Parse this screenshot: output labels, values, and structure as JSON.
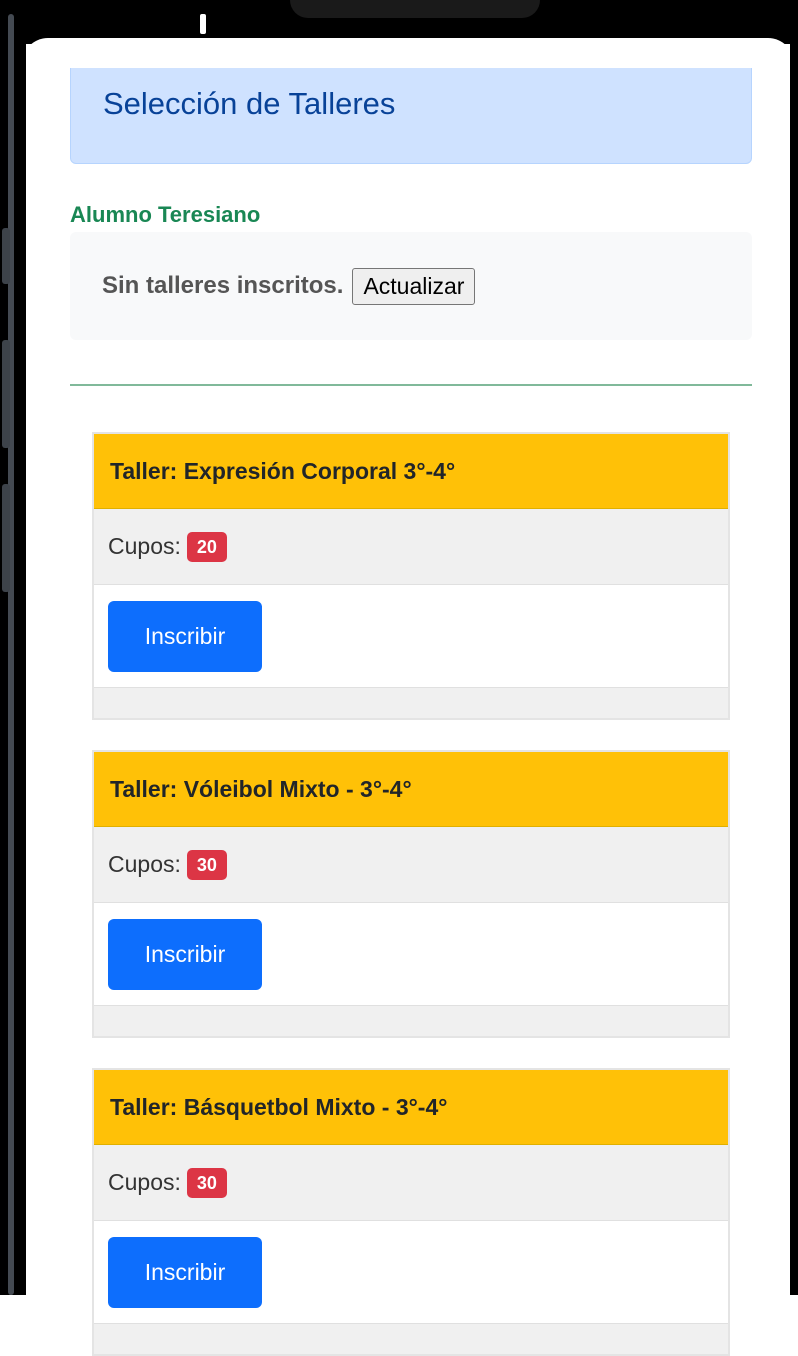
{
  "header": {
    "title": "Selección de Talleres"
  },
  "student": {
    "name": "Alumno Teresiano",
    "status_text": "Sin talleres inscritos.",
    "refresh_label": "Actualizar"
  },
  "workshops": [
    {
      "title": "Taller: Expresión Corporal 3°-4°",
      "quota_label": "Cupos:",
      "quota": "20",
      "enroll_label": "Inscribir"
    },
    {
      "title": "Taller: Vóleibol Mixto - 3°-4°",
      "quota_label": "Cupos:",
      "quota": "30",
      "enroll_label": "Inscribir"
    },
    {
      "title": "Taller: Básquetbol Mixto - 3°-4°",
      "quota_label": "Cupos:",
      "quota": "30",
      "enroll_label": "Inscribir"
    }
  ],
  "colors": {
    "header_bg": "#cfe2ff",
    "header_text": "#084298",
    "student_name": "#198754",
    "card_header": "#ffc107",
    "badge": "#dc3545",
    "primary_button": "#0d6efd"
  }
}
